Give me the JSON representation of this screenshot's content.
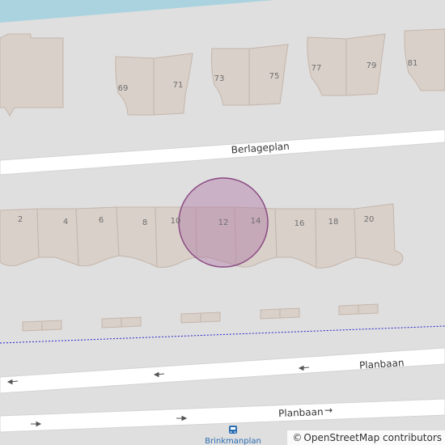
{
  "map": {
    "streets": {
      "top": "Berlageplan",
      "middle": "Planbaan",
      "bottom": "Planbaan",
      "bottom_arrow": "→"
    },
    "house_numbers": {
      "n69": "69",
      "n71": "71",
      "n73": "73",
      "n75": "75",
      "n77": "77",
      "n79": "79",
      "n81": "81",
      "n2": "2",
      "n4": "4",
      "n6": "6",
      "n8": "8",
      "n10": "10",
      "n12": "12",
      "n14": "14",
      "n16": "16",
      "n18": "18",
      "n20": "20"
    },
    "bus_stop": {
      "label": "Brinkmanplan",
      "icon": "bus-icon"
    },
    "highlight": {
      "color": "#b07aa6",
      "stroke": "#8a4b83"
    },
    "colors": {
      "land": "#e0dfdf",
      "water": "#aad3df",
      "building": "#d9d0c9",
      "building_stroke": "#c4b6ab",
      "road": "#ffffff",
      "path": "#2222cc"
    }
  },
  "attribution": {
    "symbol": "©",
    "text": "OpenStreetMap contributors"
  }
}
